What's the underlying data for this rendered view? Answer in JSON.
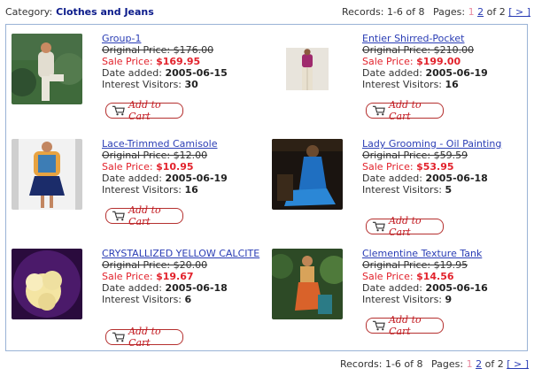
{
  "header": {
    "category_label": "Category:",
    "category_value": "Clothes and Jeans",
    "records": "Records: 1-6 of 8",
    "pages_label": "Pages:",
    "page_1": "1",
    "page_2": "2",
    "of_2": "of 2",
    "next": "[ > ]"
  },
  "products": [
    {
      "name": "Group-1",
      "original": "Original Price: $176.00",
      "sale_label": "Sale Price: ",
      "sale_value": "$169.95",
      "date_label": "Date added: ",
      "date_value": "2005-06-15",
      "visitors_label": "Interest Visitors: ",
      "visitors_value": "30",
      "add_to_cart": "Add to Cart"
    },
    {
      "name": "Entier Shirred-Pocket",
      "original": "Original Price: $210.00",
      "sale_label": "Sale Price: ",
      "sale_value": "$199.00",
      "date_label": "Date added: ",
      "date_value": "2005-06-19",
      "visitors_label": "Interest Visitors: ",
      "visitors_value": "16",
      "add_to_cart": "Add to Cart"
    },
    {
      "name": "Lace-Trimmed Camisole",
      "original": "Original Price: $12.00",
      "sale_label": "Sale Price: ",
      "sale_value": "$10.95",
      "date_label": "Date added: ",
      "date_value": "2005-06-19",
      "visitors_label": "Interest Visitors: ",
      "visitors_value": "16",
      "add_to_cart": "Add to Cart"
    },
    {
      "name": "Lady Grooming - Oil Painting",
      "original": "Original Price: $59.59",
      "sale_label": "Sale Price: ",
      "sale_value": "$53.95",
      "date_label": "Date added: ",
      "date_value": "2005-06-18",
      "visitors_label": "Interest Visitors: ",
      "visitors_value": "5",
      "add_to_cart": "Add to Cart"
    },
    {
      "name": "CRYSTALLIZED YELLOW CALCITE",
      "original": "Original Price: $20.00",
      "sale_label": "Sale Price: ",
      "sale_value": "$19.67",
      "date_label": "Date added: ",
      "date_value": "2005-06-18",
      "visitors_label": "Interest Visitors: ",
      "visitors_value": "6",
      "add_to_cart": "Add to Cart"
    },
    {
      "name": "Clementine Texture Tank",
      "original": "Original Price: $19.95",
      "sale_label": "Sale Price: ",
      "sale_value": "$14.56",
      "date_label": "Date added: ",
      "date_value": "2005-06-16",
      "visitors_label": "Interest Visitors: ",
      "visitors_value": "9",
      "add_to_cart": "Add to Cart"
    }
  ],
  "footer": {
    "records": "Records: 1-6 of 8",
    "pages_label": "Pages:",
    "page_1": "1",
    "page_2": "2",
    "of_2": "of 2",
    "next": "[ > ]"
  }
}
